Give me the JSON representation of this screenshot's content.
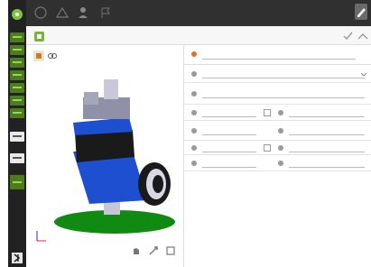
{
  "colors": {
    "accent_green": "#7ec242",
    "sidebar_bg": "#222222",
    "topbar_bg": "#303030",
    "robot_blue": "#1e4fd1",
    "floor_green": "#108a10"
  },
  "sidebar": {
    "items": [
      {
        "icon": "flow-icon"
      },
      {
        "icon": "grid-icon"
      },
      {
        "icon": "list-icon"
      },
      {
        "icon": "check-icon"
      },
      {
        "icon": "tool-icon"
      },
      {
        "icon": "robot-icon"
      },
      {
        "icon": "program-icon"
      },
      {
        "icon": "record-icon"
      },
      {
        "icon": "record-icon"
      },
      {
        "icon": "settings-icon"
      }
    ]
  },
  "topbar": {
    "buttons": [
      {
        "icon": "home-icon"
      },
      {
        "icon": "warning-icon"
      },
      {
        "icon": "user-icon"
      },
      {
        "icon": "flag-icon"
      }
    ],
    "right_icon": "edit-icon"
  },
  "header": {
    "small_label": "",
    "title": "",
    "actions": [
      "checkmark-icon",
      "chevron-up-icon"
    ]
  },
  "view3d": {
    "tabs": [
      "orange-view-icon",
      "link-icon"
    ],
    "tools": [
      "hand-icon",
      "zoom-icon",
      "fit-icon"
    ]
  },
  "props": {
    "rows": []
  }
}
